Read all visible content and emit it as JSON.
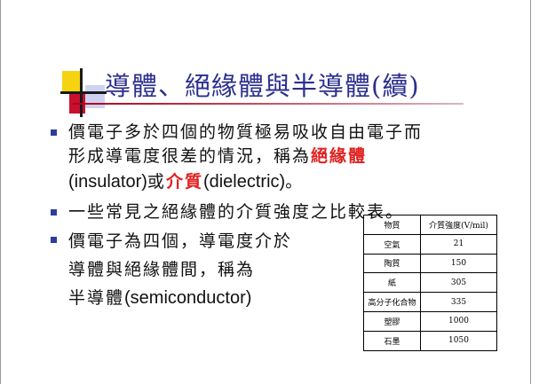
{
  "slide": {
    "title": "導體、絕緣體與半導體(續)",
    "bullets": [
      {
        "lines": [
          {
            "segments": [
              {
                "text": "價電子多於四個的物質極易吸收自由電子而",
                "style": "normal"
              }
            ]
          },
          {
            "segments": [
              {
                "text": "形成導電度很差的情況，稱為",
                "style": "normal"
              },
              {
                "text": "絕緣體",
                "style": "emphasis"
              }
            ]
          },
          {
            "segments": [
              {
                "text": "(insulator)",
                "style": "sans"
              },
              {
                "text": "或",
                "style": "normal"
              },
              {
                "text": "介質",
                "style": "emphasis"
              },
              {
                "text": "(dielectric)",
                "style": "sans"
              },
              {
                "text": "。",
                "style": "normal"
              }
            ]
          }
        ]
      },
      {
        "lines": [
          {
            "segments": [
              {
                "text": "一些常見之絕緣體的介質強度之比較表。",
                "style": "normal"
              }
            ]
          }
        ]
      },
      {
        "lines": [
          {
            "segments": [
              {
                "text": "價電子為四個，導電度介於",
                "style": "normal"
              }
            ]
          },
          {
            "segments": [
              {
                "text": "導體與絕緣體間，稱為",
                "style": "normal"
              }
            ]
          },
          {
            "segments": [
              {
                "text": "半導體",
                "style": "normal"
              },
              {
                "text": "(semiconductor)",
                "style": "sans"
              }
            ]
          }
        ]
      }
    ],
    "colors": {
      "title": "#2b2f8f",
      "emphasis": "#e0201e",
      "bullet": "#2e3d9c",
      "deco_yellow": "#f5d311",
      "deco_red": "#c8102e"
    }
  },
  "table": {
    "headers": [
      "物質",
      "介質強度(V/mil)"
    ],
    "rows": [
      [
        "空氣",
        "21"
      ],
      [
        "陶質",
        "150"
      ],
      [
        "紙",
        "305"
      ],
      [
        "高分子化合物",
        "335"
      ],
      [
        "塑膠",
        "1000"
      ],
      [
        "石墨",
        "1050"
      ]
    ]
  }
}
